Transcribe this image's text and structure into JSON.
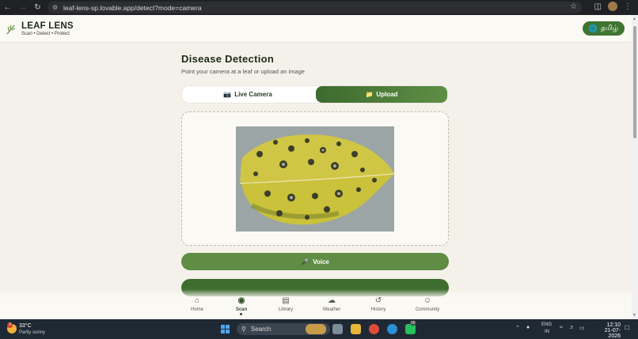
{
  "browser": {
    "url": "leaf-lens-sp.lovable.app/detect?mode=camera"
  },
  "header": {
    "brand": "LEAF LENS",
    "tagline": "Scan • Detect • Protect",
    "language_button": "தமிழ்"
  },
  "page": {
    "title": "Disease Detection",
    "subtitle": "Point your camera at a leaf or upload an image"
  },
  "mode_tabs": [
    {
      "icon": "camera-icon",
      "label": "Live Camera",
      "selected": false
    },
    {
      "icon": "folder-icon",
      "label": "Upload",
      "selected": true
    }
  ],
  "actions": {
    "voice_label": "Voice"
  },
  "bottom_nav": [
    {
      "label": "Home",
      "icon": "home-icon"
    },
    {
      "label": "Scan",
      "icon": "camera-icon",
      "active": true
    },
    {
      "label": "Library",
      "icon": "book-icon"
    },
    {
      "label": "Weather",
      "icon": "cloud-icon"
    },
    {
      "label": "History",
      "icon": "history-icon"
    },
    {
      "label": "Community",
      "icon": "users-icon"
    }
  ],
  "taskbar": {
    "weather_temp": "33°C",
    "weather_desc": "Partly sunny",
    "weather_badge": "3",
    "search_placeholder": "Search",
    "whatsapp_badge": "88",
    "lang_line1": "ENG",
    "lang_line2": "IN",
    "time": "12:10",
    "date": "21-07-2026"
  },
  "colors": {
    "primary_green": "#3f7431",
    "background": "#f4f1ea"
  }
}
